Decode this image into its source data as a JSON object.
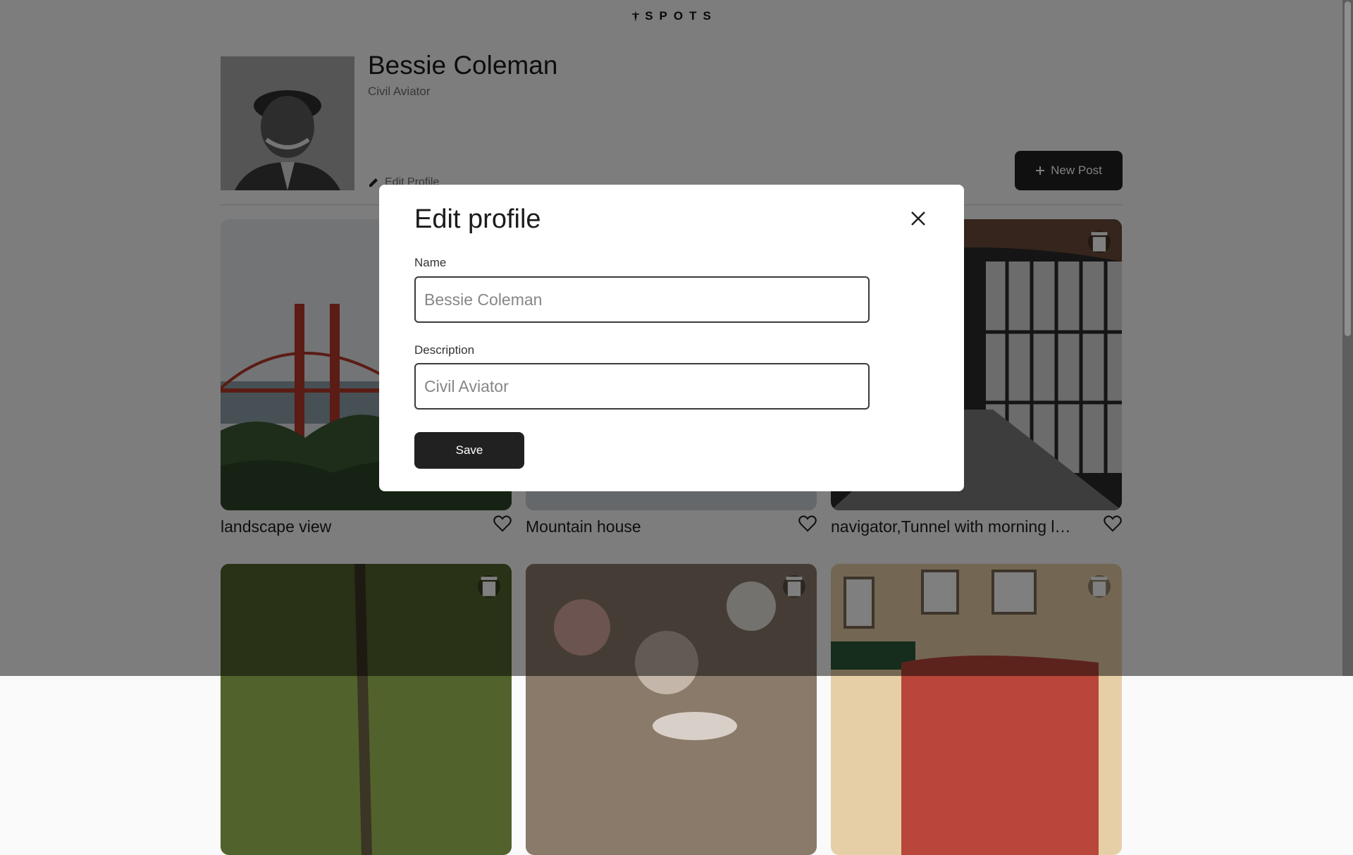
{
  "app": {
    "logo": "SPOTS"
  },
  "profile": {
    "name": "Bessie Coleman",
    "description": "Civil Aviator",
    "edit_label": "Edit Profile",
    "new_post_label": "New Post"
  },
  "cards": [
    {
      "caption": "landscape view"
    },
    {
      "caption": "Mountain house"
    },
    {
      "caption": "navigator,Tunnel with morning light"
    },
    {
      "caption": ""
    },
    {
      "caption": ""
    },
    {
      "caption": ""
    }
  ],
  "modal": {
    "title": "Edit profile",
    "name_label": "Name",
    "name_value": "Bessie Coleman",
    "description_label": "Description",
    "description_value": "Civil Aviator",
    "save_label": "Save"
  },
  "icons": {
    "logo": "compass-icon",
    "edit": "pencil-icon",
    "new_post": "plus-icon",
    "delete": "trash-icon",
    "like": "heart-icon",
    "close": "close-icon"
  }
}
